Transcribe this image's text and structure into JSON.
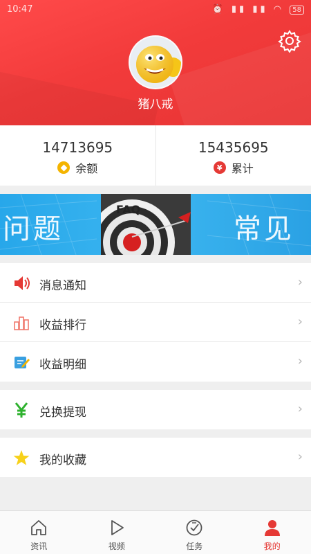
{
  "status_bar": {
    "time": "10:47",
    "battery": "58"
  },
  "profile": {
    "username": "猪八戒"
  },
  "stats": [
    {
      "value": "14713695",
      "label": "余额",
      "icon": "gold-coin-icon"
    },
    {
      "value": "15435695",
      "label": "累计",
      "icon": "yen-coin-icon"
    }
  ],
  "banner": {
    "left_text": "问题",
    "right_text": "常见",
    "badge_text": "FAQ"
  },
  "menu_group1": [
    {
      "label": "消息通知",
      "icon": "speaker-icon"
    },
    {
      "label": "收益排行",
      "icon": "ranking-chart-icon"
    },
    {
      "label": "收益明细",
      "icon": "edit-note-icon"
    }
  ],
  "menu_group2": [
    {
      "label": "兑换提现",
      "icon": "yen-icon"
    }
  ],
  "menu_group3": [
    {
      "label": "我的收藏",
      "icon": "star-icon"
    }
  ],
  "bottom_nav": [
    {
      "label": "资讯",
      "icon": "home-icon",
      "active": false
    },
    {
      "label": "视频",
      "icon": "play-icon",
      "active": false
    },
    {
      "label": "任务",
      "icon": "task-check-icon",
      "active": false
    },
    {
      "label": "我的",
      "icon": "user-icon",
      "active": true
    }
  ],
  "colors": {
    "accent": "#e53935",
    "header": "#f23b3b",
    "banner": "#2ea8ea"
  }
}
